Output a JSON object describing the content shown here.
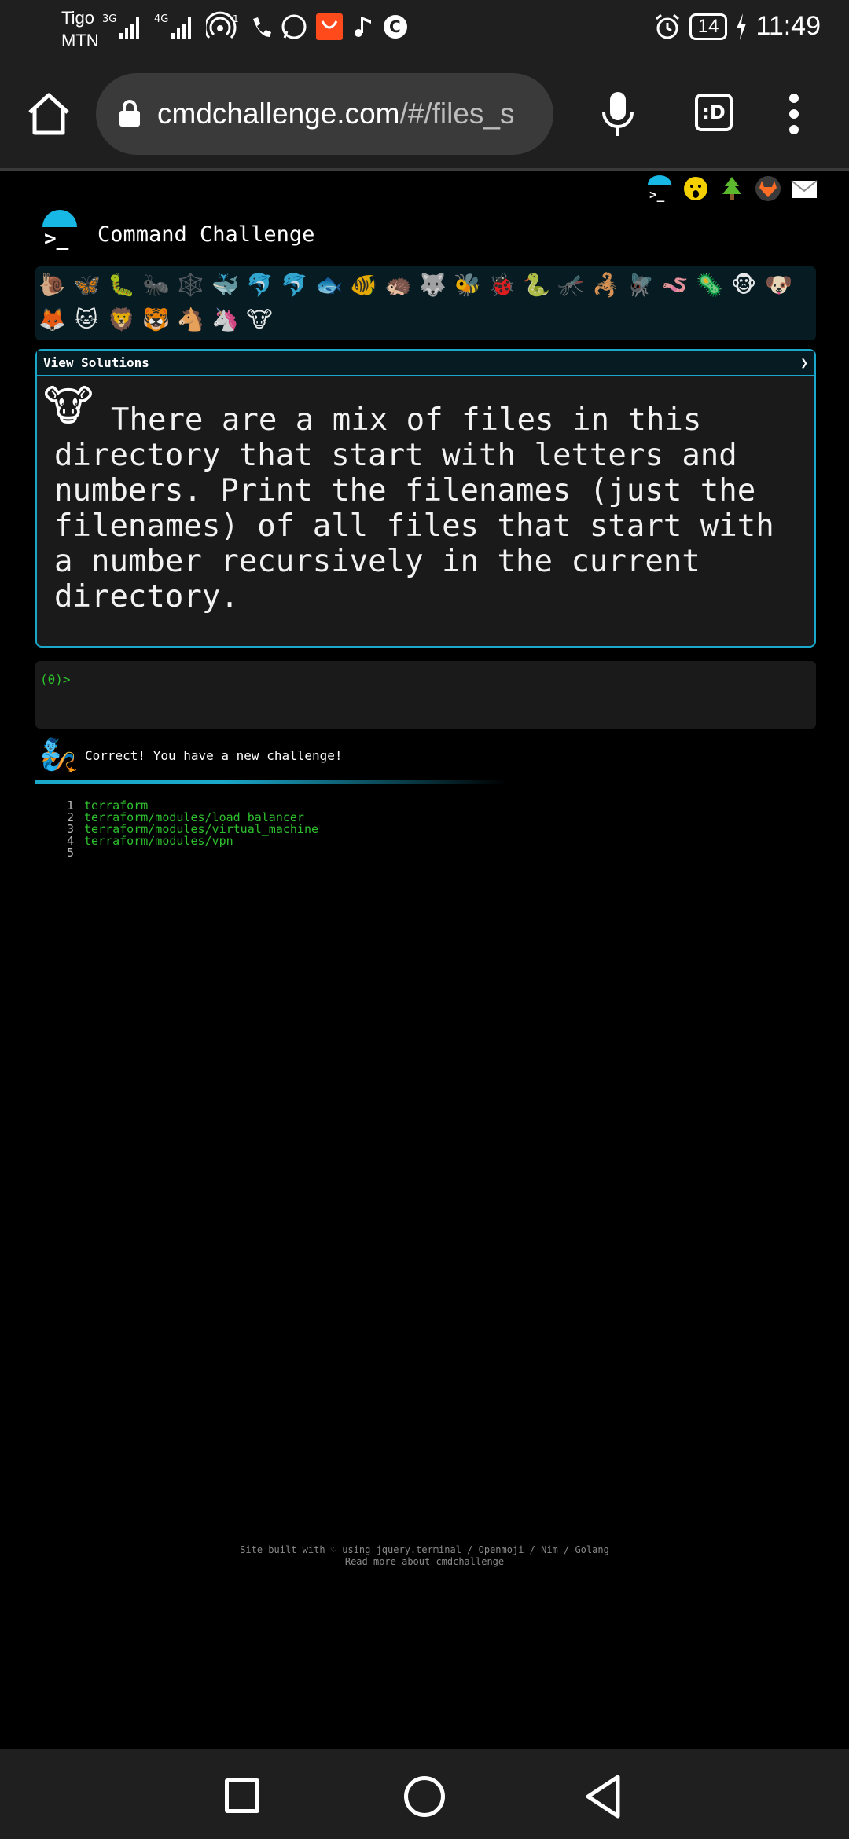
{
  "status_bar": {
    "carrier_line1": "Tigo",
    "carrier_line2": "MTN",
    "battery": "14",
    "time": "11:49",
    "icons": [
      "3g-signal-icon",
      "4g-signal-icon",
      "hotspot-icon",
      "phone-icon",
      "whatsapp-icon",
      "app-notification-icon",
      "music-icon",
      "c-app-icon",
      "alarm-icon",
      "charging-icon"
    ]
  },
  "browser": {
    "url_main": "cmdchallenge.com",
    "url_path": "/#/files_s",
    "tabs_label": ":D"
  },
  "header": {
    "title": "Command Challenge",
    "logo_prompt": ">_",
    "top_icons": [
      "cmdchallenge-icon",
      "emoji-face-icon",
      "tree-icon",
      "gitlab-icon",
      "mail-icon"
    ]
  },
  "emoji_strip": {
    "items": [
      "🐌",
      "🦋",
      "🐛",
      "🐜",
      "🕸️",
      "🐳",
      "🐬",
      "🐬",
      "🐟",
      "🐠",
      "🦔",
      "🐺",
      "🐝",
      "🐞",
      "🐍",
      "🦟",
      "🦂",
      "🪰",
      "🪱",
      "🦠",
      "🐵",
      "🐶",
      "🦊",
      "🐱",
      "🦁",
      "🐯",
      "🐴",
      "🦄",
      "🐮"
    ]
  },
  "challenge": {
    "header_label": "View Solutions",
    "expand_glyph": "❯",
    "icon": "🐮",
    "text": "There are a mix of files in this directory that start with letters and numbers. Print the filenames (just the filenames) of all files that start with a number recursively in the current directory."
  },
  "terminal": {
    "prompt": "(0)>"
  },
  "result": {
    "icon": "🧞",
    "message": "Correct! You have a new challenge!"
  },
  "output": {
    "lines": [
      {
        "num": "1",
        "text": "terraform"
      },
      {
        "num": "2",
        "text": "terraform/modules/load_balancer"
      },
      {
        "num": "3",
        "text": "terraform/modules/virtual_machine"
      },
      {
        "num": "4",
        "text": "terraform/modules/vpn"
      },
      {
        "num": "5",
        "text": ""
      }
    ]
  },
  "footer": {
    "line1": "Site built with ♡ using jquery.terminal / Openmoji / Nim / Golang",
    "line2": "Read more about cmdchallenge"
  }
}
